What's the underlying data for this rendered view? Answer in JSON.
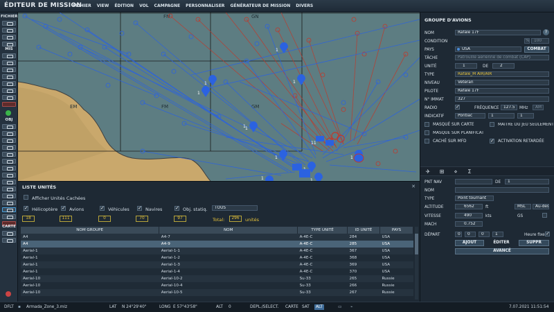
{
  "app": {
    "title": "ÉDITEUR DE MISSION"
  },
  "menu": [
    "FICHIER",
    "VIEW",
    "ÉDITION",
    "VOL",
    "CAMPAGNE",
    "PERSONNALISER",
    "GÉNÉRATEUR DE MISSION",
    "DIVERS"
  ],
  "toolbar": {
    "fichier_label": "FICHIER",
    "mis_label": "MIS",
    "obj_label": "OBJ",
    "carte_label": "CARTE"
  },
  "map": {
    "grid_labels": [
      "FN",
      "GN",
      "EM",
      "FM",
      "GM"
    ],
    "colors": {
      "sea": "#5d7d82",
      "land": "#c9a86c",
      "blue": "#2b62e0",
      "red": "#c0392b",
      "grid": "#1a1a1a"
    },
    "group_markers": [
      "1",
      "1",
      "1",
      "1",
      "1",
      "1",
      "1",
      "1",
      "1",
      "1",
      "1",
      "11"
    ]
  },
  "group_panel": {
    "title": "GROUPE D'AVIONS",
    "labels": {
      "nom": "NOM",
      "condition": "CONDITION",
      "pays": "PAYS",
      "tache": "TÂCHE",
      "unite": "UNITÉ",
      "de": "DE",
      "type": "TYPE",
      "niveau": "NIVEAU",
      "pilote": "PILOTE",
      "immat": "N° IMMAT",
      "radio": "RADIO",
      "frequence": "FRÉQUENCE",
      "mhz": "MHz",
      "am": "AM",
      "indicatif": "INDICATIF"
    },
    "values": {
      "nom": "Rafale 17F",
      "condition": "%",
      "condition_val": "100",
      "pays": "USA",
      "tache": "Patrouille aérienne de combat (CAP)",
      "unite": "1",
      "unite_de": "2",
      "type": "Rafale_M AIR/AIR",
      "niveau": "Vétéran",
      "pilote": "Rafale 17F",
      "immat": "327",
      "frequence": "127.5",
      "indicatif": "Pontiac",
      "indicatif_n1": "1",
      "indicatif_n2": "1"
    },
    "combat_button": "COMBAT",
    "help": "?",
    "checks": {
      "masque_carte": "MASQUÉ SUR CARTE",
      "maitre_jeu": "MAÎTRE DU JEU SEULEMENT",
      "masque_planif": "MASQUÉ SUR PLANIFICATION",
      "cache_mfd": "CACHÉ SUR MFD",
      "activation": "ACTIVATION RETARDÉE"
    }
  },
  "waypoint_panel": {
    "labels": {
      "pnt_nav": "PNT NAV",
      "de": "DE",
      "nom": "NOM",
      "type": "TYPE",
      "altitude": "ALTITUDE",
      "vitesse": "VITESSE",
      "mach": "MACH",
      "depart": "DÉPART",
      "gs": "GS",
      "heure_fixe": "Heure fixe"
    },
    "values": {
      "de": "1",
      "type": "Point tournant",
      "altitude": "6562",
      "alt_unit": "ft",
      "alt_ref": "MSL",
      "alt_auto": "Au-dessus",
      "vitesse": "490",
      "vit_unit": "kts",
      "mach": "0.752",
      "depart_d": "0",
      "depart_h": "0",
      "depart_m": "0",
      "depart_s": "1"
    },
    "buttons": {
      "ajout": "AJOUT",
      "editer": "ÉDITER",
      "suppr": "SUPPR",
      "avance": "AVANCÉ"
    },
    "tab_icons": [
      "aircraft-icon",
      "payload-icon",
      "waypoint-icon",
      "triggers-icon"
    ]
  },
  "unit_list": {
    "title": "LISTE UNITÉS",
    "afficher_cachees": "Afficher Unités Cachées",
    "filters": [
      {
        "label": "Hélicoptère",
        "count": "18"
      },
      {
        "label": "Avions",
        "count": "111"
      },
      {
        "label": "Véhicules",
        "count": "0"
      },
      {
        "label": "Navires",
        "count": "70"
      },
      {
        "label": "Obj. statiq.",
        "count": "97"
      }
    ],
    "coalition": "TOUS",
    "total_label": "Total:",
    "total": "296",
    "total_unit": "unités",
    "columns": [
      "NOM GROUPE",
      "NOM",
      "TYPE UNITÉ",
      "ID UNITÉ",
      "PAYS"
    ],
    "rows": [
      [
        "A4",
        "A4-7",
        "A-4E-C",
        "284",
        "USA"
      ],
      [
        "A4",
        "A4-9",
        "A-4E-C",
        "285",
        "USA"
      ],
      [
        "Aerial-1",
        "Aerial-1-1",
        "A-4E-C",
        "367",
        "USA"
      ],
      [
        "Aerial-1",
        "Aerial-1-2",
        "A-4E-C",
        "368",
        "USA"
      ],
      [
        "Aerial-1",
        "Aerial-1-3",
        "A-4E-C",
        "369",
        "USA"
      ],
      [
        "Aerial-1",
        "Aerial-1-4",
        "A-4E-C",
        "370",
        "USA"
      ],
      [
        "Aerial-10",
        "Aerial-10-2",
        "Su-33",
        "265",
        "Russie"
      ],
      [
        "Aerial-10",
        "Aerial-10-4",
        "Su-33",
        "266",
        "Russie"
      ],
      [
        "Aerial-10",
        "Aerial-10-5",
        "Su-33",
        "267",
        "Russie"
      ]
    ],
    "selected_row": 1
  },
  "status": {
    "mode": "DFLT",
    "file": "Armada_Zone_3.miz",
    "lat_label": "LAT",
    "lat": "N 24°29'40\"",
    "long_label": "LONG",
    "long": "E 57°43'58\"",
    "alt_label": "ALT",
    "alt": "0",
    "depl_select": "DEPL./SELECT.",
    "carte": "CARTE",
    "sat": "SAT",
    "alt_mode": "ALT",
    "datetime": "7.07.2021 11:51:54"
  }
}
